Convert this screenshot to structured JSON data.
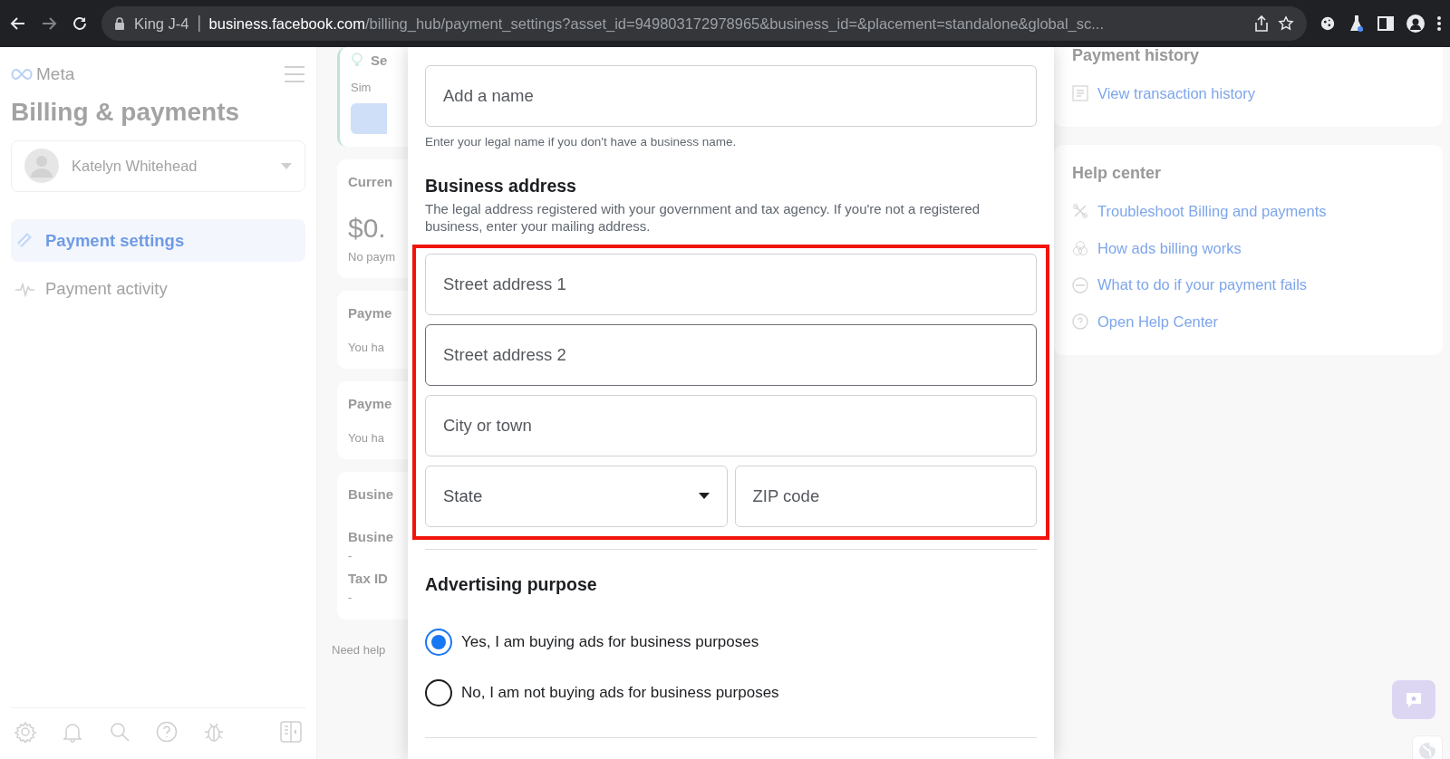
{
  "browser": {
    "tab_label": "King J-4",
    "url_host": "business.facebook.com",
    "url_path": "/billing_hub/payment_settings?asset_id=949803172978965&business_id=&placement=standalone&global_sc...",
    "forward_disabled": true
  },
  "sidebar": {
    "brand": "Meta",
    "title": "Billing & payments",
    "account": "Katelyn Whitehead",
    "items": [
      {
        "label": "Payment settings",
        "selected": true
      },
      {
        "label": "Payment activity",
        "selected": false
      }
    ]
  },
  "background_cards": [
    {
      "kind": "tip",
      "title": "Se",
      "text": "Sim"
    },
    {
      "kind": "balance",
      "title": "Curren",
      "amount": "$0.",
      "text": "No paym"
    },
    {
      "kind": "plain",
      "title": "Payme",
      "text": "You ha"
    },
    {
      "kind": "plain",
      "title": "Payme",
      "text": "You ha"
    },
    {
      "kind": "details",
      "title": "Busine",
      "fields": [
        {
          "label": "Busine",
          "value": "-"
        },
        {
          "label": "Tax ID",
          "value": "-"
        }
      ]
    }
  ],
  "need_help": "Need help",
  "modal": {
    "name_field": {
      "placeholder": "Add a name",
      "hint": "Enter your legal name if you don't have a business name."
    },
    "address": {
      "heading": "Business address",
      "description": "The legal address registered with your government and tax agency. If you're not a registered business, enter your mailing address.",
      "highlighted": true,
      "fields": [
        {
          "kind": "text",
          "placeholder": "Street address 1",
          "focused": false
        },
        {
          "kind": "text",
          "placeholder": "Street address 2",
          "focused": true
        },
        {
          "kind": "text",
          "placeholder": "City or town",
          "focused": false
        },
        {
          "kind": "select",
          "placeholder": "State",
          "focused": false
        },
        {
          "kind": "text",
          "placeholder": "ZIP code",
          "focused": false
        }
      ]
    },
    "purpose": {
      "heading": "Advertising purpose",
      "options": [
        {
          "label": "Yes, I am buying ads for business purposes",
          "selected": true
        },
        {
          "label": "No, I am not buying ads for business purposes",
          "selected": false
        }
      ]
    }
  },
  "payment_history": {
    "title": "Payment history",
    "link": "View transaction history"
  },
  "help_center": {
    "title": "Help center",
    "links": [
      "Troubleshoot Billing and payments",
      "How ads billing works",
      "What to do if your payment fails",
      "Open Help Center"
    ]
  }
}
